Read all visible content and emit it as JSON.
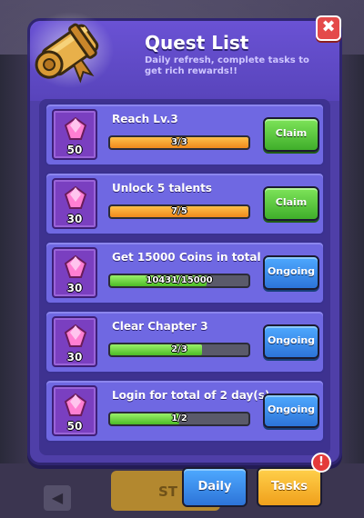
{
  "window": {
    "title": "Quest List",
    "subtitle": "Daily refresh, complete tasks to get rich rewards!!"
  },
  "colors": {
    "panel": "#4f3fa8",
    "header": "#6a52d4",
    "card": "#6f68e2",
    "claim_green": "#3fae2a",
    "ongoing_blue": "#2d74d8",
    "progress_orange": "#f08a1c",
    "progress_green": "#4cbc26",
    "close_red": "#e44a4a"
  },
  "icons": {
    "header": "scroll-icon",
    "close": "close-icon",
    "reward": "gem-icon",
    "alert": "exclamation-icon"
  },
  "quests": [
    {
      "label": "Reach Lv.3",
      "reward": "50",
      "progress_text": "3/3",
      "progress": 1.0,
      "bar_color": "orange",
      "action": "Claim",
      "state": "claim"
    },
    {
      "label": "Unlock 5 talents",
      "reward": "30",
      "progress_text": "7/5",
      "progress": 1.0,
      "bar_color": "orange",
      "action": "Claim",
      "state": "claim"
    },
    {
      "label": "Get 15000 Coins in total",
      "reward": "30",
      "progress_text": "10431/15000",
      "progress": 0.6954,
      "bar_color": "green",
      "action": "Ongoing",
      "state": "ongoing"
    },
    {
      "label": "Clear Chapter 3",
      "reward": "30",
      "progress_text": "2/3",
      "progress": 0.6667,
      "bar_color": "green",
      "action": "Ongoing",
      "state": "ongoing"
    },
    {
      "label": "Login for total of 2 day(s)",
      "reward": "50",
      "progress_text": "1/2",
      "progress": 0.5,
      "bar_color": "green",
      "action": "Ongoing",
      "state": "ongoing"
    }
  ],
  "tabs": {
    "daily": "Daily",
    "tasks": "Tasks",
    "alert": "!"
  },
  "background": {
    "stage_button": "ST"
  }
}
